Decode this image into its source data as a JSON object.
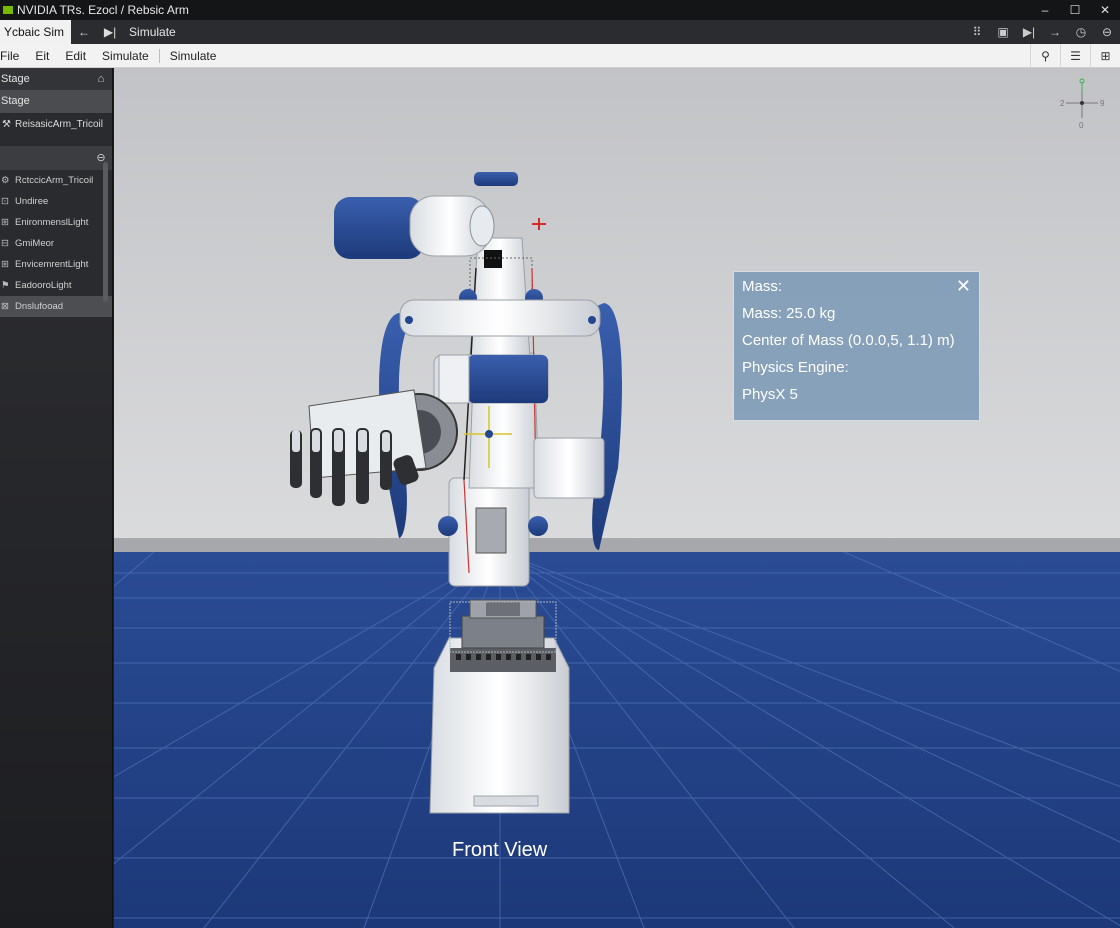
{
  "window": {
    "title": "NVIDIA  TRs. Ezocl / Rebsic Arm"
  },
  "window_controls": {
    "minimize": "–",
    "maximize": "☐",
    "close": "✕"
  },
  "toolbar": {
    "app_tab": "Ycbaic Sim",
    "back_icon": "←",
    "step_icon": "▶|",
    "simulate": "Simulate",
    "right_icons": [
      "⠿",
      "▣",
      "▶|",
      "→",
      "◷",
      "⊖"
    ]
  },
  "menubar": {
    "items": [
      "File",
      "Eit",
      "Edit",
      "Simulate",
      "Simulate"
    ],
    "right_icons": [
      "⚲",
      "☰",
      "⊞"
    ]
  },
  "stage_panel": {
    "header": "Stage",
    "header_icon": "⌂",
    "stage_label": "Stage",
    "root_item": "ReisasicArm_Tricoil",
    "subheader_icon": "⊖",
    "tree": [
      "RctccicArm_Tricoil",
      "Undiree",
      "EnironmenslLight",
      "GmiMeor",
      "EnvicemrentLight",
      "EadooroLight",
      "Dnslufooad"
    ]
  },
  "viewport": {
    "info_panel": {
      "close_icon": "✕",
      "lines": [
        "Mass:",
        "Mass: 25.0 kg",
        "Center of Mass (0.0.0,5, 1.1) m)",
        "Physics Engine:",
        "PhysX 5"
      ]
    },
    "view_label": "Front View",
    "gizmo": {
      "left": "2",
      "right": "9",
      "top": "0",
      "bottom": "0"
    }
  },
  "colors": {
    "floor": "#1f3f86",
    "wall": "#c9cacc",
    "accent_blue": "#24468f",
    "nvidia_green": "#76b900"
  }
}
